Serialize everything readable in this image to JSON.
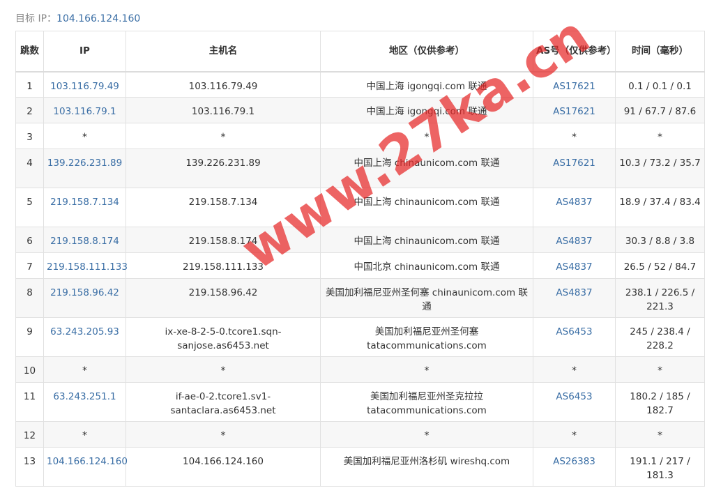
{
  "target": {
    "label": "目标 IP：",
    "ip": "104.166.124.160"
  },
  "table": {
    "headers": [
      "跳数",
      "IP",
      "主机名",
      "地区（仅供参考）",
      "AS号（仅供参考）",
      "时间（毫秒）"
    ],
    "rows": [
      {
        "hop": "1",
        "ip": "103.116.79.49",
        "host": "103.116.79.49",
        "region": "中国上海 igongqi.com 联通",
        "as": "AS17621",
        "time": "0.1 / 0.1 / 0.1"
      },
      {
        "hop": "2",
        "ip": "103.116.79.1",
        "host": "103.116.79.1",
        "region": "中国上海 igongqi.com 联通",
        "as": "AS17621",
        "time": "91 / 67.7 / 87.6"
      },
      {
        "hop": "3",
        "ip": "*",
        "host": "*",
        "region": "*",
        "as": "*",
        "time": "*"
      },
      {
        "hop": "4",
        "ip": "139.226.231.89",
        "host": "139.226.231.89",
        "region": "中国上海 chinaunicom.com 联通",
        "as": "AS17621",
        "time": "10.3 / 73.2 / 35.7"
      },
      {
        "hop": "5",
        "ip": "219.158.7.134",
        "host": "219.158.7.134",
        "region": "中国上海 chinaunicom.com 联通",
        "as": "AS4837",
        "time": "18.9 / 37.4 / 83.4"
      },
      {
        "hop": "6",
        "ip": "219.158.8.174",
        "host": "219.158.8.174",
        "region": "中国上海 chinaunicom.com 联通",
        "as": "AS4837",
        "time": "30.3 / 8.8 / 3.8"
      },
      {
        "hop": "7",
        "ip": "219.158.111.133",
        "host": "219.158.111.133",
        "region": "中国北京 chinaunicom.com 联通",
        "as": "AS4837",
        "time": "26.5 / 52 / 84.7"
      },
      {
        "hop": "8",
        "ip": "219.158.96.42",
        "host": "219.158.96.42",
        "region": "美国加利福尼亚州圣何塞 chinaunicom.com 联通",
        "as": "AS4837",
        "time": "238.1 / 226.5 / 221.3"
      },
      {
        "hop": "9",
        "ip": "63.243.205.93",
        "host": "ix-xe-8-2-5-0.tcore1.sqn-sanjose.as6453.net",
        "region": "美国加利福尼亚州圣何塞 tatacommunications.com",
        "as": "AS6453",
        "time": "245 / 238.4 / 228.2"
      },
      {
        "hop": "10",
        "ip": "*",
        "host": "*",
        "region": "*",
        "as": "*",
        "time": "*"
      },
      {
        "hop": "11",
        "ip": "63.243.251.1",
        "host": "if-ae-0-2.tcore1.sv1-santaclara.as6453.net",
        "region": "美国加利福尼亚州圣克拉拉 tatacommunications.com",
        "as": "AS6453",
        "time": "180.2 / 185 / 182.7"
      },
      {
        "hop": "12",
        "ip": "*",
        "host": "*",
        "region": "*",
        "as": "*",
        "time": "*"
      },
      {
        "hop": "13",
        "ip": "104.166.124.160",
        "host": "104.166.124.160",
        "region": "美国加利福尼亚州洛杉矶 wireshq.com",
        "as": "AS26383",
        "time": "191.1 / 217 / 181.3"
      }
    ]
  },
  "watermark": "www.27ka.cn",
  "colors": {
    "link": "#3a6ea5",
    "border": "#e1e1e1",
    "stripe": "#f7f7f7",
    "watermark": "#e62828"
  }
}
